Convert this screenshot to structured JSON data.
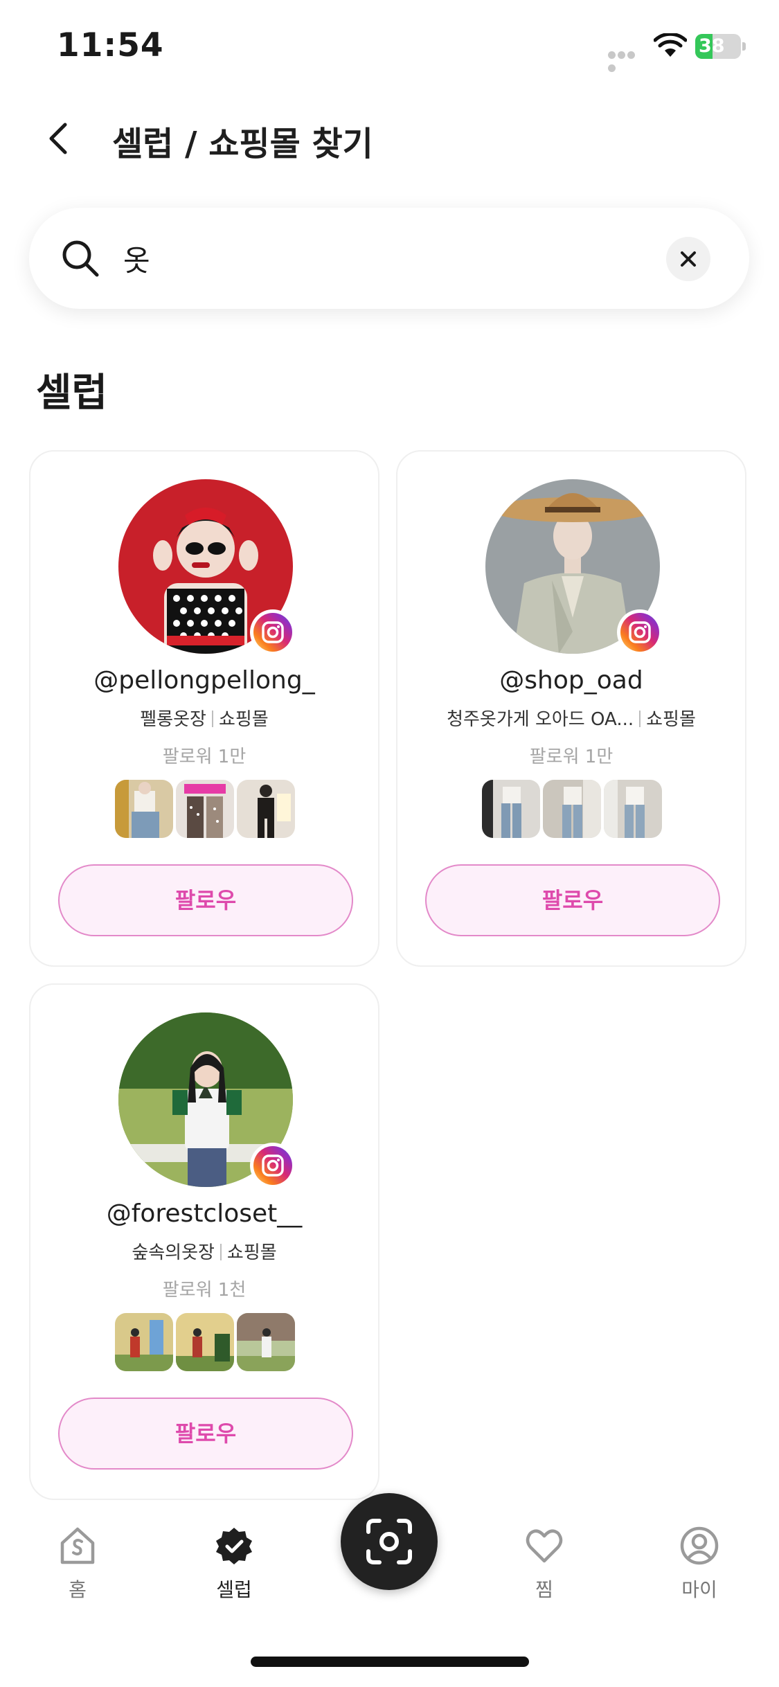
{
  "status_bar": {
    "time": "11:54",
    "battery": "38",
    "battery_level": 0.38
  },
  "header": {
    "title": "셀럽 / 쇼핑몰 찾기"
  },
  "search": {
    "value": "옷",
    "placeholder": ""
  },
  "section": {
    "title": "셀럽"
  },
  "cards": [
    {
      "handle": "@pellongpellong_",
      "name": "펠롱옷장",
      "category": "쇼핑몰",
      "followers": "팔로워 1만",
      "follow_label": "팔로우"
    },
    {
      "handle": "@shop_oad",
      "name": "청주옷가게 오아드 OA...",
      "category": "쇼핑몰",
      "followers": "팔로워 1만",
      "follow_label": "팔로우"
    },
    {
      "handle": "@forestcloset__",
      "name": "숲속의옷장",
      "category": "쇼핑몰",
      "followers": "팔로워 1천",
      "follow_label": "팔로우"
    }
  ],
  "tab_bar": {
    "items": [
      {
        "label": "홈",
        "icon": "home-icon"
      },
      {
        "label": "셀럽",
        "icon": "verified-badge-icon",
        "active": true
      },
      {
        "label": "",
        "icon": "camera-scan-icon"
      },
      {
        "label": "찜",
        "icon": "heart-icon"
      },
      {
        "label": "마이",
        "icon": "user-circle-icon"
      }
    ]
  },
  "colors": {
    "accent": "#de4aac",
    "accent_bg": "#fdf0fa",
    "battery_green": "#34c759"
  }
}
